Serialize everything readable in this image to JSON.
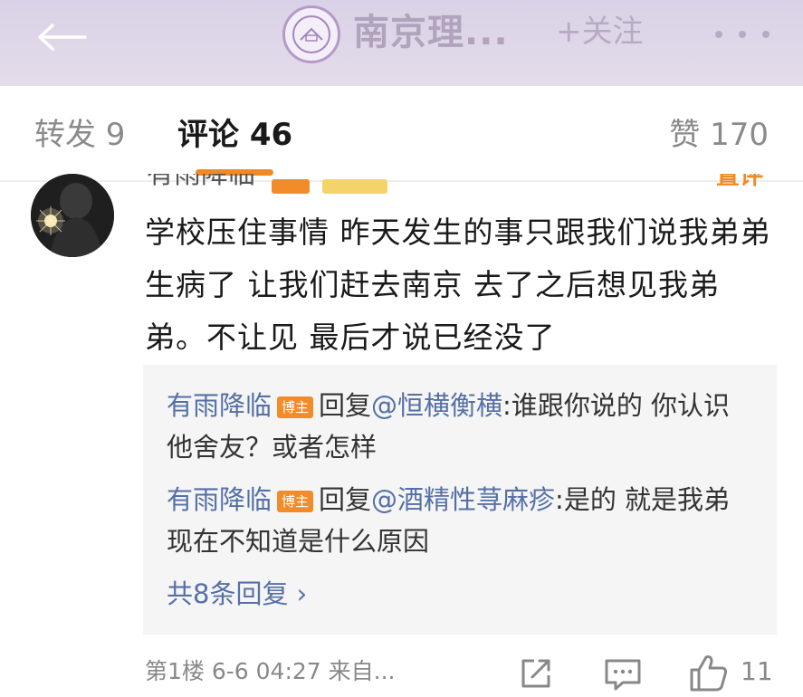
{
  "header": {
    "account_name": "南京理...",
    "follow_label": "+关注"
  },
  "tabs": {
    "repost": "转发 9",
    "comments": "评论 46",
    "likes": "赞 170"
  },
  "comment": {
    "author_partial": "有雨降临",
    "partial_right": "置评",
    "text": "学校压住事情 昨天发生的事只跟我们说我弟弟生病了 让我们赶去南京 去了之后想见我弟弟。不让见 最后才说已经没了",
    "floor": "第1楼",
    "time": "6-6 04:27",
    "source": "来自...",
    "like_count": "11"
  },
  "replies": [
    {
      "user": "有雨降临",
      "badge": "博主",
      "reply_word": "回复",
      "mention": "@恒横衡横",
      "text": ":谁跟你说的 你认识他舍友？或者怎样"
    },
    {
      "user": "有雨降临",
      "badge": "博主",
      "reply_word": "回复",
      "mention": "@酒精性荨麻疹",
      "text": ":是的 就是我弟 现在不知道是什么原因"
    }
  ],
  "more_replies": "共8条回复 ›",
  "colors": {
    "accent": "#f08a24",
    "link": "#5570a6",
    "header_bg": "#d9d2e6"
  }
}
